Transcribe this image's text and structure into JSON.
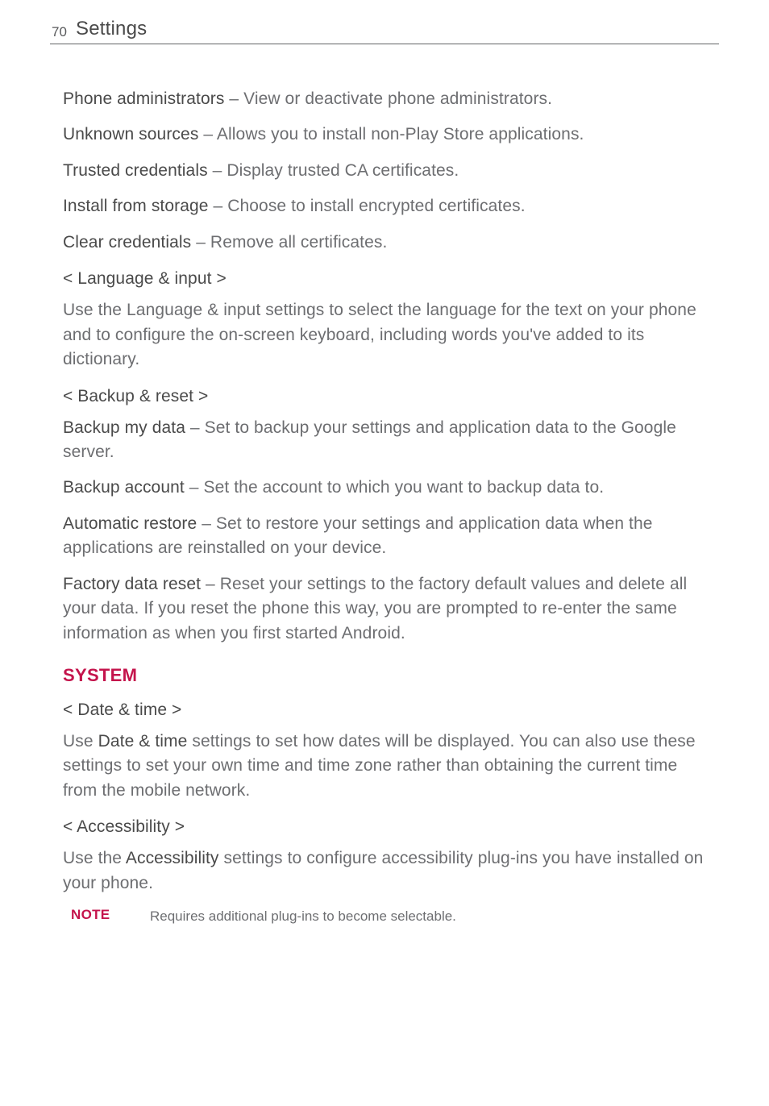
{
  "header": {
    "page_number": "70",
    "title": "Settings"
  },
  "items": [
    {
      "lead": "Phone administrators",
      "rest": " – View or deactivate phone administrators."
    },
    {
      "lead": "Unknown sources",
      "rest": " – Allows you to install non-Play Store applications."
    },
    {
      "lead": "Trusted credentials",
      "rest": " – Display trusted CA certificates."
    },
    {
      "lead": "Install from storage",
      "rest": " – Choose to install encrypted certificates."
    },
    {
      "lead": "Clear credentials",
      "rest": " – Remove all certificates."
    }
  ],
  "lang_input": {
    "heading": "< Language & input >",
    "body": "Use the Language & input settings to select the language for the text on your phone and to configure the on-screen keyboard, including words you've added to its dictionary."
  },
  "backup": {
    "heading": "< Backup & reset >",
    "rows": [
      {
        "lead": "Backup my data",
        "rest": " – Set to backup your settings and application data to the Google server."
      },
      {
        "lead": "Backup account",
        "rest": " – Set the account to which you want to backup data to."
      },
      {
        "lead": "Automatic restore",
        "rest": " – Set to restore your settings and application data when the applications are reinstalled on your device."
      },
      {
        "lead": "Factory data reset",
        "rest": " – Reset your settings to the factory default values and delete all your data. If you reset the phone this way, you are prompted to re-enter the same information as when you first started Android."
      }
    ]
  },
  "system": {
    "heading": "SYSTEM",
    "date_time": {
      "heading": "< Date & time >",
      "pre": "Use ",
      "bold": "Date & time",
      "post": " settings to set how dates will be displayed. You can also use these settings to set your own time and time zone rather than obtaining the current time from the mobile network."
    },
    "accessibility": {
      "heading": "< Accessibility >",
      "pre": "Use the ",
      "bold": "Accessibility",
      "post": " settings to configure accessibility plug-ins you have installed on your phone."
    },
    "note": {
      "label": "NOTE",
      "text": "Requires additional plug-ins to become selectable."
    }
  }
}
